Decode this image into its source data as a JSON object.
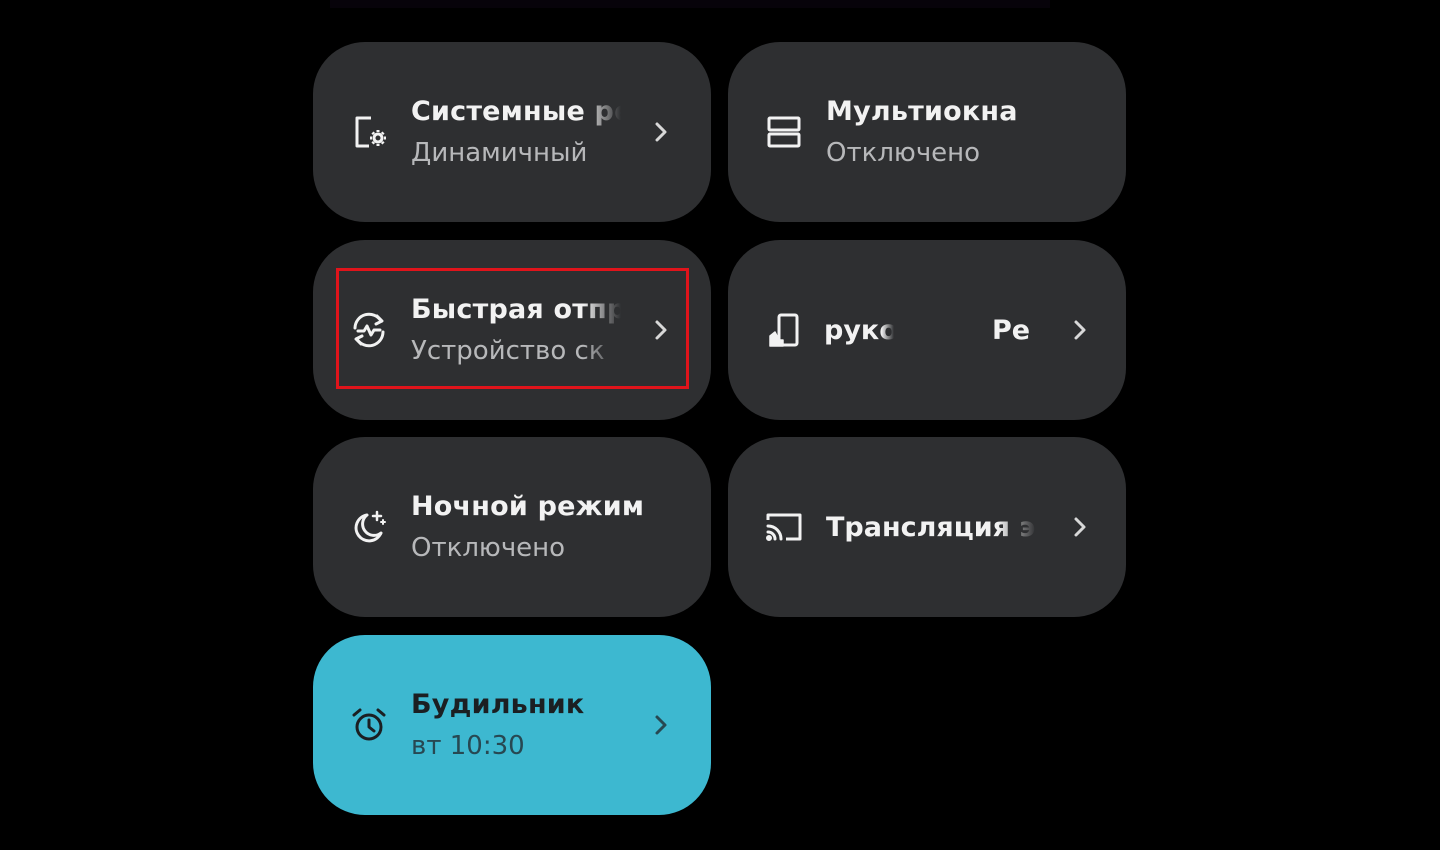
{
  "colors": {
    "background": "#000000",
    "tile": "#2e2f31",
    "tile_active": "#3db8d0",
    "highlight": "#e0141b"
  },
  "tiles": [
    {
      "icon": "phone-settings-icon",
      "title": "Системные ре",
      "subtitle": "Динамичный",
      "has_chevron": true
    },
    {
      "icon": "multiwindow-icon",
      "title": "Мультиокна",
      "subtitle": "Отключено",
      "has_chevron": false
    },
    {
      "icon": "quick-share-icon",
      "title": "Быстрая отпр",
      "subtitle": "Устройство ск",
      "has_chevron": true,
      "highlighted": true
    },
    {
      "icon": "one-hand-mode-icon",
      "title": "рукой",
      "title_extra": "Ре",
      "has_chevron": true
    },
    {
      "icon": "night-mode-moon-icon",
      "title": "Ночной режим",
      "subtitle": "Отключено",
      "has_chevron": false
    },
    {
      "icon": "cast-screen-icon",
      "title": "Трансляция эк",
      "has_chevron": true
    },
    {
      "icon": "alarm-clock-icon",
      "title": "Будильник",
      "subtitle": "вт 10:30",
      "has_chevron": true,
      "active": true
    }
  ]
}
